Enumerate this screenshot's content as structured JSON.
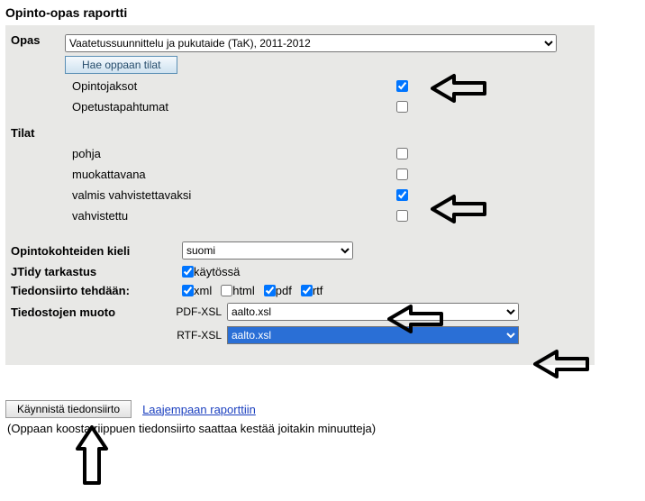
{
  "title": "Opinto-opas raportti",
  "opas": {
    "label": "Opas",
    "selected": "Vaatetussuunnittelu ja pukutaide (TaK), 2011-2012",
    "hae_btn": "Hae oppaan tilat"
  },
  "items": {
    "opintojaksot": {
      "label": "Opintojaksot",
      "checked": true
    },
    "opetustapahtumat": {
      "label": "Opetustapahtumat",
      "checked": false
    }
  },
  "tilat": {
    "header": "Tilat",
    "pohja": {
      "label": "pohja",
      "checked": false
    },
    "muokattavana": {
      "label": "muokattavana",
      "checked": false
    },
    "valmis": {
      "label": "valmis vahvistettavaksi",
      "checked": true
    },
    "vahvistettu": {
      "label": "vahvistettu",
      "checked": false
    }
  },
  "kieli": {
    "label": "Opintokohteiden kieli",
    "selected": "suomi"
  },
  "jtidy": {
    "label": "JTidy tarkastus",
    "checkbox_label": "käytössä",
    "checked": true
  },
  "transfer": {
    "label": "Tiedonsiirto tehdään:",
    "xml": {
      "label": "xml",
      "checked": true
    },
    "html": {
      "label": "html",
      "checked": false
    },
    "pdf": {
      "label": "pdf",
      "checked": true
    },
    "rtf": {
      "label": "rtf",
      "checked": true
    }
  },
  "fileformat": {
    "label": "Tiedostojen muoto",
    "pdf_xsl_label": "PDF-XSL",
    "pdf_xsl_value": "aalto.xsl",
    "rtf_xsl_label": "RTF-XSL",
    "rtf_xsl_value": "aalto.xsl"
  },
  "launch": {
    "btn": "Käynnistä tiedonsiirto",
    "link": "Laajempaan raporttiin",
    "note": "(Oppaan koosta riippuen tiedonsiirto saattaa kestää joitakin minuutteja)"
  }
}
